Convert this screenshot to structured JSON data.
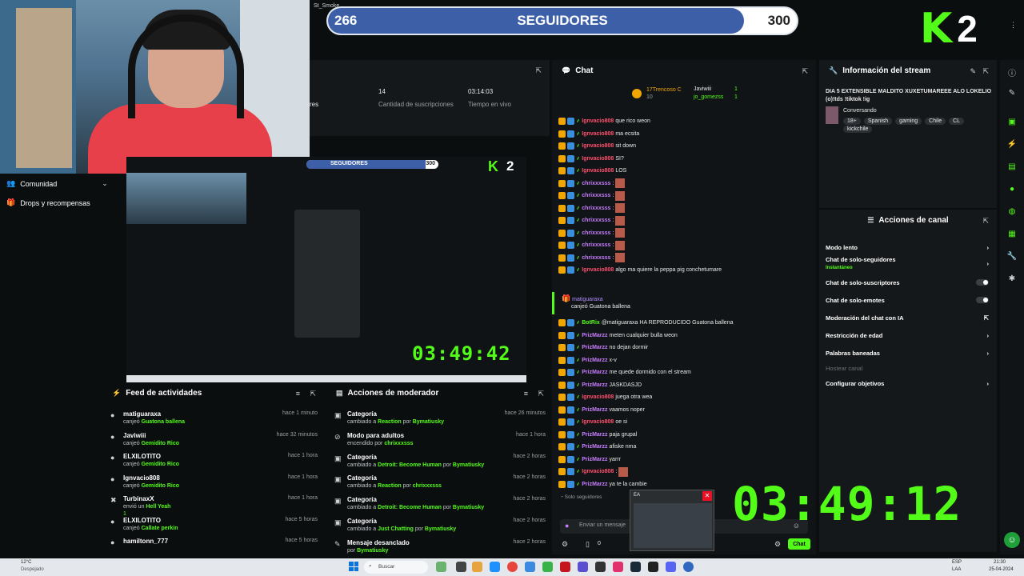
{
  "overlay": {
    "followers_current": "266",
    "followers_label": "SEGUIDORES",
    "followers_goal": "300",
    "progress_fraction": 0.887,
    "brand_k": "K",
    "brand_number": "2",
    "window_title": "St_Smoke"
  },
  "stats": {
    "suscripciones_value": "14",
    "suscripciones_label": "Cantidad de suscripciones",
    "tiempo_value": "03:14:03",
    "tiempo_label": "Tiempo en vivo",
    "partial_label": "res"
  },
  "nav": {
    "community": "Comunidad",
    "drops": "Drops y recompensas"
  },
  "preview": {
    "followers_label": "SEGUIDORES",
    "followers_goal": "300",
    "brand_number": "2",
    "timer": "03:49:42"
  },
  "feed": {
    "title": "Feed de actividades",
    "items": [
      {
        "name": "matiguaraxa",
        "action": "canjeó ",
        "detail": "Guatona ballena",
        "time": "hace 1 minuto"
      },
      {
        "name": "Javiwiii",
        "action": "canjeó ",
        "detail": "Gemidito Rico",
        "time": "hace 32 minutos"
      },
      {
        "name": "ELXILOTITO",
        "action": "canjeó ",
        "detail": "Gemidito Rico",
        "time": "hace 1 hora"
      },
      {
        "name": "Ignvacio808",
        "action": "canjeó ",
        "detail": "Gemidito Rico",
        "time": "hace 1 hora"
      },
      {
        "name": "TurbinaxX",
        "action": "envió un ",
        "detail": "Hell Yeah",
        "time": "hace 1 hora",
        "extra": "1"
      },
      {
        "name": "ELXILOTITO",
        "action": "canjeó ",
        "detail": "Callate perkin",
        "time": "hace 5 horas"
      },
      {
        "name": "hamiltonn_777",
        "action": "",
        "detail": "",
        "time": "hace 5 horas"
      }
    ]
  },
  "modactions": {
    "title": "Acciones de moderador",
    "items": [
      {
        "name": "Categoría",
        "action": "cambiado a ",
        "detail": "Reaction",
        "by": "Bymatiusky",
        "time": "hace 26 minutos"
      },
      {
        "name": "Modo para adultos",
        "action": "encendido por ",
        "detail": "chrixxxsss",
        "by": "",
        "time": "hace 1 hora"
      },
      {
        "name": "Categoría",
        "action": "cambiado a ",
        "detail": "Detroit: Become Human",
        "by": "Bymatiusky",
        "time": "hace 2 horas"
      },
      {
        "name": "Categoría",
        "action": "cambiado a ",
        "detail": "Reaction",
        "by": "chrixxxsss",
        "time": "hace 2 horas"
      },
      {
        "name": "Categoría",
        "action": "cambiado a ",
        "detail": "Detroit: Become Human",
        "by": "Bymatiusky",
        "time": "hace 2 horas"
      },
      {
        "name": "Categoría",
        "action": "cambiado a ",
        "detail": "Just Chatting",
        "by": "Bymatiusky",
        "time": "hace 2 horas"
      },
      {
        "name": "Mensaje desanclado",
        "action": "por ",
        "detail": "Bymatiusky",
        "by": "",
        "time": "hace 2 horas"
      }
    ],
    "por": " por "
  },
  "chat": {
    "title": "Chat",
    "top_users": [
      {
        "name": "17Trencoso C",
        "n": "10"
      },
      {
        "name": "Javiwiii",
        "n": "1"
      },
      {
        "name": "jo_gomezss",
        "n": "1"
      }
    ],
    "messages": [
      {
        "user": "Ignvacio808",
        "color": "red",
        "text": " que rico weon"
      },
      {
        "user": "Ignvacio808",
        "color": "red",
        "text": " ma ecsita"
      },
      {
        "user": "Ignvacio808",
        "color": "red",
        "text": " sit down"
      },
      {
        "user": "Ignvacio808",
        "color": "red",
        "text": " SI?"
      },
      {
        "user": "Ignvacio808",
        "color": "red",
        "text": " LOS"
      },
      {
        "user": "chrixxxsss",
        "color": "purple",
        "text": ":",
        "emote": true
      },
      {
        "user": "chrixxxsss",
        "color": "purple",
        "text": ":",
        "emote": true
      },
      {
        "user": "chrixxxsss",
        "color": "purple",
        "text": ":",
        "emote": true
      },
      {
        "user": "chrixxxsss",
        "color": "purple",
        "text": ":",
        "emote": true
      },
      {
        "user": "chrixxxsss",
        "color": "purple",
        "text": ":",
        "emote": true
      },
      {
        "user": "chrixxxsss",
        "color": "purple",
        "text": ":",
        "emote": true
      },
      {
        "user": "chrixxxsss",
        "color": "purple",
        "text": ":",
        "emote": true
      },
      {
        "user": "Ignvacio808",
        "color": "red",
        "text": " algo ma quiere la peppa pig conchetumare"
      }
    ],
    "redeem_user": "matiguaraxa",
    "redeem_text": "canjeó Guatona ballena",
    "messages2": [
      {
        "user": "BotRix",
        "color": "green",
        "text": " @matiguaraxa HA REPRODUCIDO Guatona ballena"
      },
      {
        "user": "PrizMarzz",
        "color": "purple",
        "text": " meten cualquier bulla weon"
      },
      {
        "user": "PrizMarzz",
        "color": "purple",
        "text": " no dejan dormir"
      },
      {
        "user": "PrizMarzz",
        "color": "purple",
        "text": " x-v"
      },
      {
        "user": "PrizMarzz",
        "color": "purple",
        "text": " me quede dormido con el stream"
      },
      {
        "user": "PrizMarzz",
        "color": "purple",
        "text": " JASKDASJD"
      },
      {
        "user": "Ignvacio808",
        "color": "red",
        "text": " juega otra wea"
      },
      {
        "user": "PrizMarzz",
        "color": "purple",
        "text": " vaamos noper"
      },
      {
        "user": "Ignvacio808",
        "color": "red",
        "text": " oe si"
      },
      {
        "user": "PrizMarzz",
        "color": "purple",
        "text": " paja grupal"
      },
      {
        "user": "PrizMarzz",
        "color": "purple",
        "text": " afiske nma"
      },
      {
        "user": "PrizMarzz",
        "color": "purple",
        "text": " yarrr"
      },
      {
        "user": "Ignvacio808",
        "color": "red",
        "text": ":",
        "emote": true
      },
      {
        "user": "PrizMarzz",
        "color": "purple",
        "text": " ya te la cambie"
      }
    ],
    "mode": "Solo seguidores",
    "input_placeholder": "Enviar un mensaje",
    "send_label": "Chat",
    "count": "0"
  },
  "info": {
    "title": "Información del stream",
    "stream_title": "DIA 5 EXTENSIBLE MALDITO XUXETUMAREEE ALO LOKELIO (o)!tds !tiktok !ig",
    "category": "Conversando",
    "tags": [
      "18+",
      "Spanish",
      "gaming",
      "Chile",
      "CL",
      "kickchile"
    ]
  },
  "actions": {
    "title": "Acciones de canal",
    "items": [
      {
        "label": "Modo lento",
        "control": "arrow"
      },
      {
        "label": "Chat de solo-seguidores",
        "sub": "Instantáneo",
        "control": "arrow"
      },
      {
        "label": "Chat de solo-suscriptores",
        "control": "toggle"
      },
      {
        "label": "Chat de solo-emotes",
        "control": "toggle"
      },
      {
        "label": "Moderación del chat con IA",
        "control": "external"
      },
      {
        "label": "Restricción de edad",
        "control": "arrow"
      },
      {
        "label": "Palabras baneadas",
        "control": "arrow"
      },
      {
        "label": "Hostear canal",
        "control": "none",
        "disabled": true
      },
      {
        "label": "Configurar objetivos",
        "control": "arrow"
      }
    ]
  },
  "big_timer": "03:49:12",
  "popup": {
    "title": "EA"
  },
  "taskbar": {
    "weather_temp": "12°C",
    "weather_desc": "Despejado",
    "search": "Buscar",
    "lang": "ESP",
    "lang2": "LAA",
    "time": "21:30",
    "date": "25-04-2024"
  },
  "colors": {
    "kick_green": "#53fc18",
    "progress_blue": "#3d5fa8",
    "panel_bg": "#15181a"
  }
}
